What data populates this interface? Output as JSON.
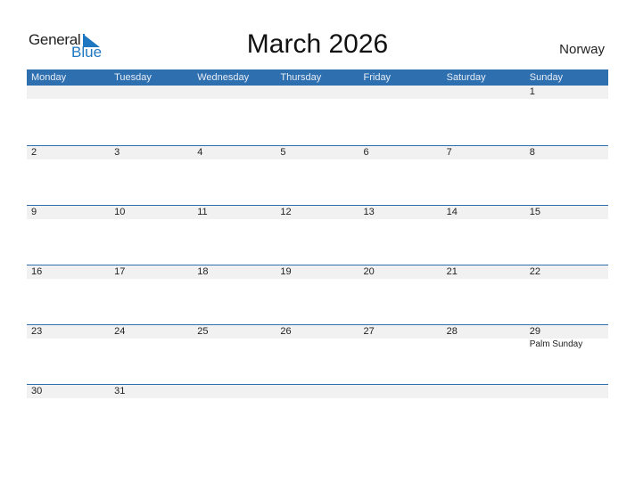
{
  "logo": {
    "word1": "General",
    "word2": "Blue"
  },
  "title": "March 2026",
  "country": "Norway",
  "days": [
    "Monday",
    "Tuesday",
    "Wednesday",
    "Thursday",
    "Friday",
    "Saturday",
    "Sunday"
  ],
  "weeks": [
    {
      "nums": [
        "",
        "",
        "",
        "",
        "",
        "",
        "1"
      ],
      "events": [
        "",
        "",
        "",
        "",
        "",
        "",
        ""
      ]
    },
    {
      "nums": [
        "2",
        "3",
        "4",
        "5",
        "6",
        "7",
        "8"
      ],
      "events": [
        "",
        "",
        "",
        "",
        "",
        "",
        ""
      ]
    },
    {
      "nums": [
        "9",
        "10",
        "11",
        "12",
        "13",
        "14",
        "15"
      ],
      "events": [
        "",
        "",
        "",
        "",
        "",
        "",
        ""
      ]
    },
    {
      "nums": [
        "16",
        "17",
        "18",
        "19",
        "20",
        "21",
        "22"
      ],
      "events": [
        "",
        "",
        "",
        "",
        "",
        "",
        ""
      ]
    },
    {
      "nums": [
        "23",
        "24",
        "25",
        "26",
        "27",
        "28",
        "29"
      ],
      "events": [
        "",
        "",
        "",
        "",
        "",
        "",
        "Palm Sunday"
      ]
    },
    {
      "nums": [
        "30",
        "31",
        "",
        "",
        "",
        "",
        ""
      ],
      "events": [
        "",
        "",
        "",
        "",
        "",
        "",
        ""
      ]
    }
  ]
}
